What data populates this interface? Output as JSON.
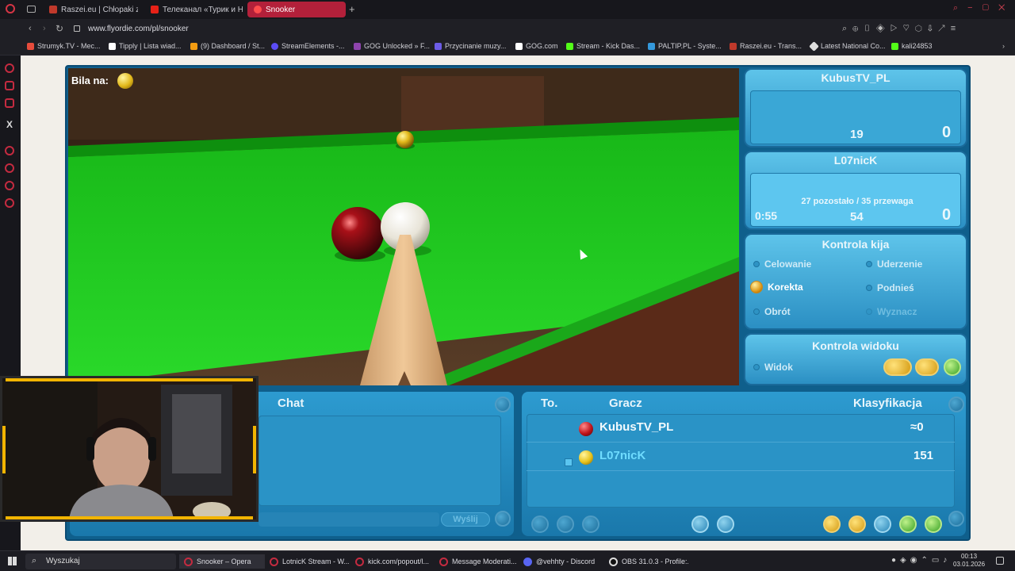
{
  "browser": {
    "tabs": [
      {
        "label": "Raszei.eu | Chłopaki z Ras",
        "color": "#c0392b"
      },
      {
        "label": "Телеканал «Турик и Н",
        "color": "#e62117"
      },
      {
        "label": "Snooker",
        "color": "#ff4d4d"
      }
    ],
    "url": "www.flyordie.com/pl/snooker",
    "bookmarks": [
      {
        "label": "Strumyk.TV - Mec...",
        "color": "#e74c3c"
      },
      {
        "label": "Tipply | Lista wiad...",
        "color": "#ffffff"
      },
      {
        "label": "(9) Dashboard / St...",
        "color": "#f39c12"
      },
      {
        "label": "StreamElements -...",
        "color": "#5b4cf5"
      },
      {
        "label": "GOG Unlocked » F...",
        "color": "#8e44ad"
      },
      {
        "label": "Przycinanie muzy...",
        "color": "#6c5ce7"
      },
      {
        "label": "GOG.com",
        "color": "#ffffff"
      },
      {
        "label": "Stream - Kick Das...",
        "color": "#53fc18"
      },
      {
        "label": "PALTIP.PL - Syste...",
        "color": "#3498db"
      },
      {
        "label": "Raszei.eu - Trans...",
        "color": "#c0392b"
      },
      {
        "label": "Latest National Co...",
        "color": "#dddddd"
      },
      {
        "label": "kali24853",
        "color": "#53fc18"
      }
    ]
  },
  "game": {
    "cue_ball_label": "Bila na:",
    "players": [
      {
        "name": "KubusTV_PL",
        "break": "19",
        "score": "0",
        "info": "",
        "timer": ""
      },
      {
        "name": "L07nicK",
        "break": "54",
        "score": "0",
        "info": "27 pozostało / 35 przewaga",
        "timer": "0:55"
      }
    ],
    "cue_control": {
      "title": "Kontrola kija",
      "options_left": [
        {
          "label": "Celowanie",
          "active": false,
          "dim": false
        },
        {
          "label": "Korekta",
          "active": true,
          "dim": false
        },
        {
          "label": "Obrót",
          "active": false,
          "dim": false
        }
      ],
      "options_right": [
        {
          "label": "Uderzenie",
          "active": false,
          "dim": false
        },
        {
          "label": "Podnieś",
          "active": false,
          "dim": false
        },
        {
          "label": "Wyznacz",
          "active": false,
          "dim": true
        }
      ]
    },
    "view_control": {
      "title": "Kontrola widoku",
      "option": "Widok"
    },
    "chat": {
      "title": "Chat",
      "send_label": "Wyślij"
    },
    "ranking": {
      "headers": {
        "to": "To.",
        "player": "Gracz",
        "rank": "Klasyfikacja"
      },
      "rows": [
        {
          "name": "KubusTV_PL",
          "ball_color": "#c0141b",
          "rank": "≈0"
        },
        {
          "name": "L07nicK",
          "ball_color": "#e6c21a",
          "rank": "151"
        }
      ]
    },
    "colors": {
      "cloth": "#1fc41f",
      "panel": "#3aa7d6",
      "frame": "#0f5f8c"
    }
  },
  "taskbar": {
    "search_placeholder": "Wyszukaj",
    "items": [
      {
        "label": "Snooker – Opera"
      },
      {
        "label": "LotnicK Stream - W..."
      },
      {
        "label": "kick.com/popout/l..."
      },
      {
        "label": "Message Moderati..."
      },
      {
        "label": "@vehhty - Discord"
      },
      {
        "label": "OBS 31.0.3 - Profile:..."
      }
    ],
    "time": "00:13",
    "date": "03.01.2026"
  }
}
